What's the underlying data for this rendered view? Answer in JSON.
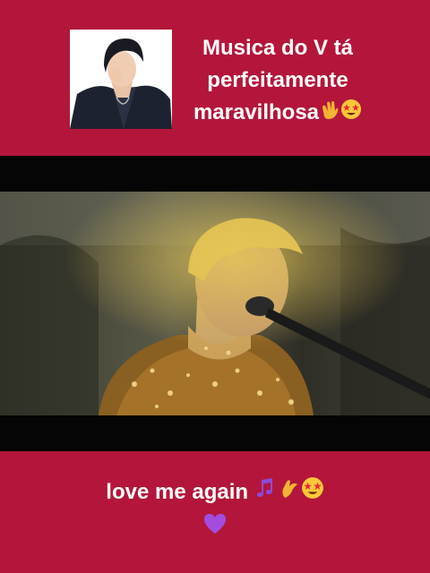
{
  "caption_top": {
    "line1": "Musica do V tá",
    "line2": "perfeitamente",
    "line3": "maravilhosa",
    "emojis": [
      "clapping-hands-icon",
      "star-struck-icon"
    ]
  },
  "caption_bottom": {
    "text": "love me again",
    "emojis": [
      "musical-notes-icon",
      "pinching-hand-icon",
      "star-struck-icon",
      "purple-heart-icon"
    ]
  },
  "colors": {
    "background": "#b3163a",
    "video_bars": "#050505",
    "text": "#ffffff"
  }
}
